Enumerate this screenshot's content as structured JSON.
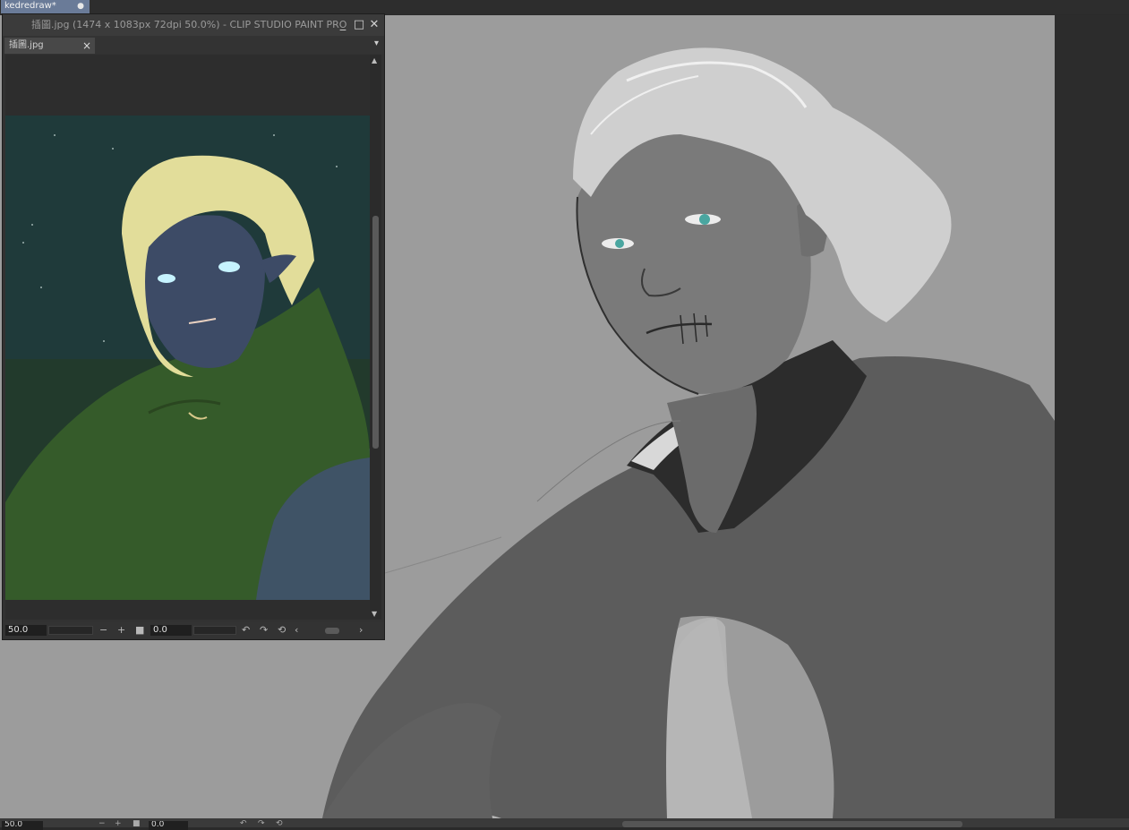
{
  "app": {
    "document_tab": "kedredraw*",
    "document_tab_dot": "●"
  },
  "subview": {
    "title": "插圖.jpg (1474 x 1083px 72dpi 50.0%)  - CLIP STUDIO PAINT PRO",
    "tab_label": "插圖.jpg",
    "zoom_value": "50.0",
    "angle_value": "0.0",
    "icons": [
      "close-icon",
      "minimize-icon",
      "maximize-icon",
      "chevron-down-icon",
      "zoom-out-icon",
      "zoom-in-icon",
      "fit-icon",
      "rotate-left-icon",
      "rotate-right-icon",
      "reset-rotation-icon",
      "scroll-left-icon",
      "scroll-right-icon"
    ]
  },
  "main_canvas": {
    "zoom_value": "50.0",
    "angle_value": "0.0"
  },
  "colors": {
    "document_tab_bg": "#6a7b98",
    "canvas_bg": "#9a9a9a",
    "reference_bg": "#1f3a38",
    "cloak_green": "#355b2a"
  }
}
